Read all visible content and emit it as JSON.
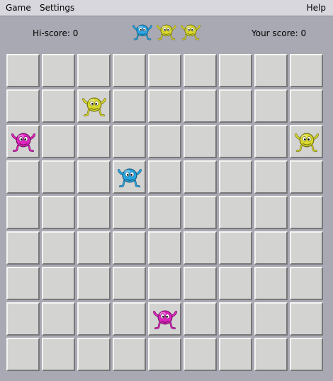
{
  "menu": {
    "game_label": "Game",
    "settings_label": "Settings",
    "help_label": "Help"
  },
  "scores": {
    "hiscore": "Hi-score: 0",
    "yourscore": "Your score: 0"
  },
  "colors": {
    "blue": "#29a8e6",
    "yellow": "#d9d92b",
    "magenta": "#e024c0"
  },
  "next_pieces": [
    "blue",
    "yellow",
    "yellow"
  ],
  "board": {
    "rows": 9,
    "cols": 9,
    "pieces": [
      {
        "row": 1,
        "col": 2,
        "color": "yellow"
      },
      {
        "row": 2,
        "col": 0,
        "color": "magenta"
      },
      {
        "row": 2,
        "col": 8,
        "color": "yellow"
      },
      {
        "row": 3,
        "col": 3,
        "color": "blue"
      },
      {
        "row": 7,
        "col": 4,
        "color": "magenta"
      }
    ]
  }
}
